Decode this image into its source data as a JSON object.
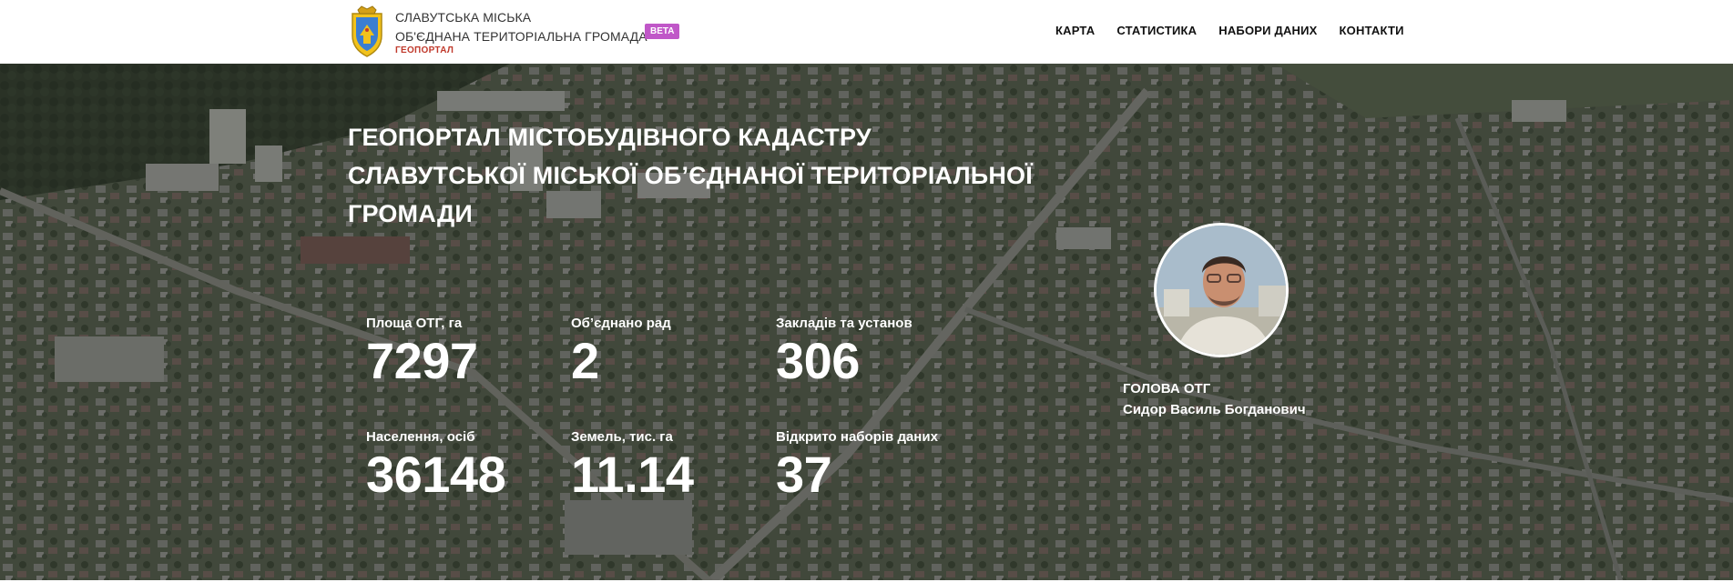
{
  "header": {
    "brand_line1": "СЛАВУТСЬКА МІСЬКА",
    "brand_line2": "ОБ'ЄДНАНА ТЕРИТОРІАЛЬНА ГРОМАДА",
    "brand_sub": "ГЕОПОРТАЛ",
    "beta": "BETA",
    "logo_icon": "coat-of-arms-icon"
  },
  "nav": {
    "items": [
      {
        "label": "КАРТА"
      },
      {
        "label": "СТАТИСТИКА"
      },
      {
        "label": "НАБОРИ ДАНИХ"
      },
      {
        "label": "КОНТАКТИ"
      }
    ]
  },
  "hero": {
    "title": "ГЕОПОРТАЛ МІСТОБУДІВНОГО КАДАСТРУ СЛАВУТСЬКОЇ МІСЬКОЇ ОБ’ЄДНАНОЇ ТЕРИТОРІАЛЬНОЇ ГРОМАДИ"
  },
  "stats": [
    {
      "label": "Площа ОТГ, га",
      "value": "7297"
    },
    {
      "label": "Об’єднано рад",
      "value": "2"
    },
    {
      "label": "Закладів та установ",
      "value": "306"
    },
    {
      "label": "Населення, осіб",
      "value": "36148"
    },
    {
      "label": "Земель, тис. га",
      "value": "11.14"
    },
    {
      "label": "Відкрито наборів даних",
      "value": "37"
    }
  ],
  "head": {
    "title": "ГОЛОВА ОТГ",
    "name": "Сидор Василь Богданович"
  },
  "colors": {
    "beta_badge": "#c057c8",
    "geoportal_sub": "#c0392b",
    "hero_text": "#ffffff"
  }
}
